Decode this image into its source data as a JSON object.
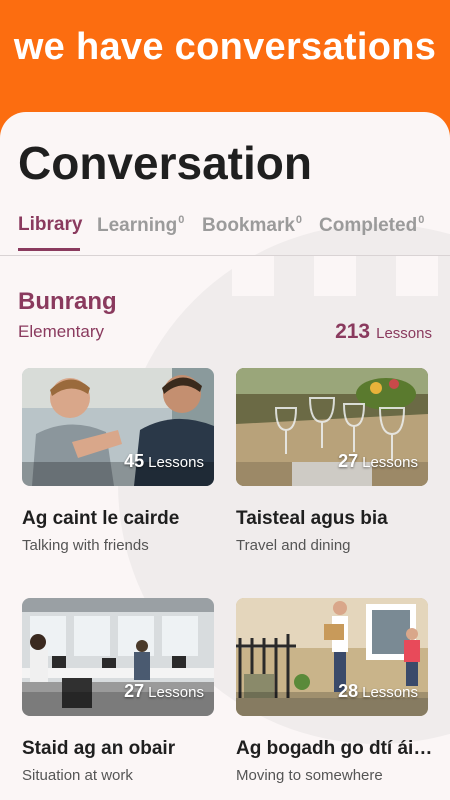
{
  "promo": {
    "text": "we have conversations"
  },
  "page": {
    "title": "Conversation"
  },
  "tabs": [
    {
      "label": "Library",
      "count": ""
    },
    {
      "label": "Learning",
      "count": "0"
    },
    {
      "label": "Bookmark",
      "count": "0"
    },
    {
      "label": "Completed",
      "count": "0"
    }
  ],
  "section": {
    "title": "Bunrang",
    "subtitle": "Elementary",
    "total_count": "213",
    "total_unit": "Lessons"
  },
  "cards": [
    {
      "title": "Ag caint le cairde",
      "subtitle": "Talking with friends",
      "count": "45",
      "unit": "Lessons",
      "image": "two-men-talking-photo"
    },
    {
      "title": "Taisteal agus bia",
      "subtitle": "Travel and dining",
      "count": "27",
      "unit": "Lessons",
      "image": "dining-table-glasses-photo"
    },
    {
      "title": "Staid ag an obair",
      "subtitle": "Situation at work",
      "count": "27",
      "unit": "Lessons",
      "image": "office-workers-photo"
    },
    {
      "title": "Ag bogadh go dtí áit eile",
      "subtitle": "Moving to somewhere",
      "count": "28",
      "unit": "Lessons",
      "image": "family-moving-boxes-photo"
    }
  ],
  "colors": {
    "accent": "#8a3a5e",
    "promo": "#fc6d10",
    "background": "#fbf6f6"
  }
}
